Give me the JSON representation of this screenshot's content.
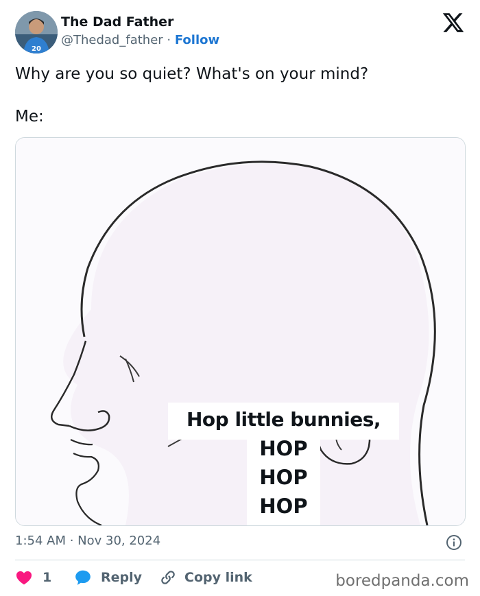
{
  "author": {
    "name": "The Dad Father",
    "handle": "@Thedad_father",
    "separator": " · ",
    "follow_label": "Follow"
  },
  "tweet": {
    "line1": "Why are you so quiet? What's on your mind?",
    "line2": "Me:"
  },
  "meme": {
    "caption": "Hop little bunnies,",
    "hops": [
      "HOP",
      "HOP",
      "HOP"
    ]
  },
  "timestamp": "1:54 AM · Nov 30, 2024",
  "actions": {
    "like_count": "1",
    "reply_label": "Reply",
    "copy_link_label": "Copy link"
  },
  "watermark": "boredpanda.com",
  "icons": {
    "platform": "x-logo-icon",
    "like": "heart-icon",
    "reply": "speech-bubble-icon",
    "copy": "link-icon",
    "info": "info-icon"
  },
  "colors": {
    "like": "#f91880",
    "reply": "#1d9bf0",
    "follow": "#1d76d2",
    "muted": "#536471"
  }
}
